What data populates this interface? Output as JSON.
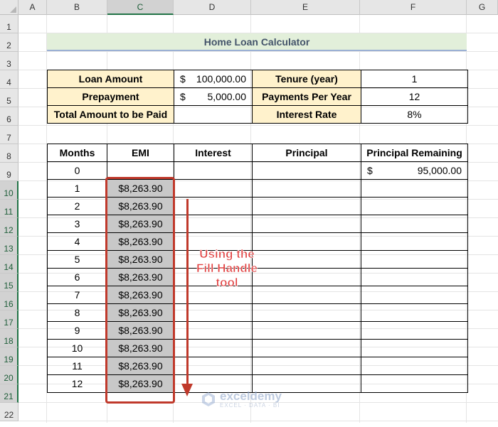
{
  "columns": [
    "A",
    "B",
    "C",
    "D",
    "E",
    "F",
    "G"
  ],
  "rows": [
    "1",
    "2",
    "3",
    "4",
    "5",
    "6",
    "7",
    "8",
    "9",
    "10",
    "11",
    "12",
    "13",
    "14",
    "15",
    "16",
    "17",
    "18",
    "19",
    "20",
    "21",
    "22"
  ],
  "title": "Home Loan Calculator",
  "inputs": {
    "loan_amount_label": "Loan Amount",
    "loan_amount_cur": "$",
    "loan_amount_value": "100,000.00",
    "prepayment_label": "Prepayment",
    "prepayment_cur": "$",
    "prepayment_value": "5,000.00",
    "total_label": "Total Amount to be Paid",
    "total_value": "",
    "tenure_label": "Tenure (year)",
    "tenure_value": "1",
    "ppy_label": "Payments Per Year",
    "ppy_value": "12",
    "rate_label": "Interest Rate",
    "rate_value": "8%"
  },
  "schedule": {
    "headers": [
      "Months",
      "EMI",
      "Interest",
      "Principal",
      "Principal Remaining"
    ],
    "row0": {
      "month": "0",
      "remaining_cur": "$",
      "remaining_value": "95,000.00"
    },
    "rows": [
      {
        "month": "1",
        "emi": "$8,263.90"
      },
      {
        "month": "2",
        "emi": "$8,263.90"
      },
      {
        "month": "3",
        "emi": "$8,263.90"
      },
      {
        "month": "4",
        "emi": "$8,263.90"
      },
      {
        "month": "5",
        "emi": "$8,263.90"
      },
      {
        "month": "6",
        "emi": "$8,263.90"
      },
      {
        "month": "7",
        "emi": "$8,263.90"
      },
      {
        "month": "8",
        "emi": "$8,263.90"
      },
      {
        "month": "9",
        "emi": "$8,263.90"
      },
      {
        "month": "10",
        "emi": "$8,263.90"
      },
      {
        "month": "11",
        "emi": "$8,263.90"
      },
      {
        "month": "12",
        "emi": "$8,263.90"
      }
    ]
  },
  "annotation": "Using the Fill Handle tool",
  "watermark": {
    "name": "exceldemy",
    "sub": "EXCEL · DATA · BI"
  },
  "colors": {
    "selection": "#217346",
    "highlight_box": "#c0392b",
    "label_fill": "#fff2cc",
    "title_fill": "#e2efda"
  }
}
